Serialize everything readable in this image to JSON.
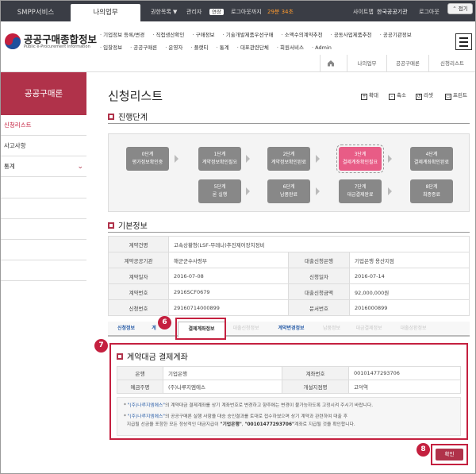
{
  "topbar": {
    "tabs": [
      "SMPP서비스",
      "나의업무"
    ],
    "auth_list": "권한목록",
    "auth_arrow": "▼",
    "admin": "관리자",
    "extend": "연장",
    "logout_until": "로그아웃까지",
    "time_left": "29분 34초",
    "site_map": "사이트맵",
    "org_name": "한국공공기관",
    "logout": "로그아웃",
    "fold": "⌃ 접기"
  },
  "header": {
    "logo_title": "공공구매종합정보",
    "logo_sub": "Public e-Procurement Information",
    "nav_items": [
      "기업정보 등록/변경",
      "직접생산확인",
      "구매정보",
      "기술개발제품우선구매",
      "소액수의계약추천",
      "공동사업제품추천",
      "공공기관정보",
      "입찰정보",
      "공공구매론",
      "공공기관정보",
      "입찰정보",
      "공공구매론",
      "공공기관정보",
      "입찰정보",
      "공공구매론"
    ],
    "nav_row1": [
      "기업정보 등록/변경",
      "직접생산확인",
      "구매정보",
      "기술개발제품우선구매",
      "소액수의계약추천",
      "공동사업제품추천",
      "공공기관정보"
    ],
    "nav_row2": [
      "입찰정보",
      "공공구매론",
      "운영자",
      "플랫티",
      "통계",
      "대표관련단체",
      "회원서비스",
      "Admin"
    ]
  },
  "breadcrumb": [
    "나의업무",
    "공공구매론",
    "신청리스트"
  ],
  "sidebar": {
    "hero": "공공구매론",
    "items": [
      {
        "label": "신청리스트",
        "active": true
      },
      {
        "label": "사고사항",
        "active": false
      },
      {
        "label": "통계",
        "active": false,
        "chevron": "⌄"
      }
    ]
  },
  "page": {
    "title": "신청리스트",
    "tools": {
      "zoom_in": "확대",
      "zoom_out": "축소",
      "reset": "리셋",
      "print": "프린트"
    }
  },
  "progress": {
    "title": "진행단계",
    "steps": [
      {
        "no": "0단계",
        "name": "평가정보확인중"
      },
      {
        "no": "1단계",
        "name": "계약정보확인필요"
      },
      {
        "no": "2단계",
        "name": "계약정보확인완료"
      },
      {
        "no": "3단계",
        "name": "결제계좌확인필요"
      },
      {
        "no": "4단계",
        "name": "결제계좌확인완료"
      },
      {
        "no": "5단계",
        "name": "론 실행"
      },
      {
        "no": "6단계",
        "name": "납품완료"
      },
      {
        "no": "7단계",
        "name": "대금결제완료"
      },
      {
        "no": "8단계",
        "name": "최종종료"
      }
    ],
    "current_step": 3
  },
  "basic_info": {
    "title": "기본정보",
    "rows": [
      {
        "label": "계약건명",
        "value": "고속상황청(LSF-무레나)추진제어장치정비"
      },
      {
        "label": "계약공공기관",
        "value": "해군군수사령부",
        "label2": "대출신청은행",
        "value2": "기업은행 용산지점"
      },
      {
        "label": "계약일자",
        "value": "2016-07-08",
        "label2": "신청일자",
        "value2": "2016-07-14"
      },
      {
        "label": "계약번호",
        "value": "2916SCF0679",
        "label2": "대출신청금액",
        "value2": "92,000,000원"
      },
      {
        "label": "신청번호",
        "value": "29160714000899",
        "label2": "문서번호",
        "value2": "2016000899"
      }
    ]
  },
  "sub_tabs": [
    "신청정보",
    "계",
    "결제계좌정보",
    "대출신청정보",
    "계약변경정보",
    "납품정보",
    "대금결제정보",
    "대출상환정보"
  ],
  "account": {
    "title": "계약대금 결제계좌",
    "bank_label": "은행",
    "bank_value": "기업은행",
    "acct_no_label": "계좌번호",
    "acct_no_value": "00101477293706",
    "holder_label": "예금주명",
    "holder_value": "(주)나루지엠에스",
    "branch_label": "개설지점명",
    "branch_value": "고덕역",
    "note1_company": "\"(주)나루지엠에스\"",
    "note1_text": "의 계약대금 결제계좌를 상기 계좌번호로 변경하고 향후에는 변경이 불가능하도록 고정시켜 주시기 바랍니다.",
    "note2_company": "\"(주)나루지엠에스\"",
    "note2_text": "의 공공구매론 실행 사항을 대승 승인결과를 토대로 접수하였으며 상기 계약과 관련하여 대출 후",
    "note3_text_a": "지급될 선금을 포함한 모든 정상적인 대금지급이 ",
    "note3_bank": "\"기업은행\"",
    "note3_sep": ", ",
    "note3_acct": "\"00101477293706\"",
    "note3_text_b": "계좌로 지급될 것을 확인합니다."
  },
  "confirm_label": "확인",
  "callouts": [
    "6",
    "7",
    "8"
  ]
}
